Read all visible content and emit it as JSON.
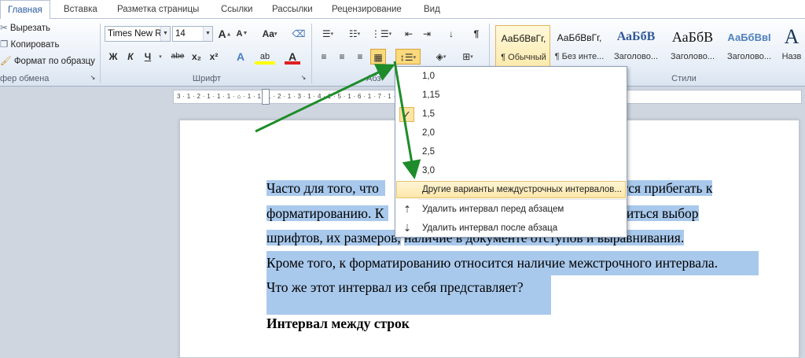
{
  "tabs": [
    "Главная",
    "Вставка",
    "Разметка страницы",
    "Ссылки",
    "Рассылки",
    "Рецензирование",
    "Вид"
  ],
  "clipboard": {
    "cut": "Вырезать",
    "copy": "Копировать",
    "format_painter": "Формат по образцу",
    "group_label": "фер обмена"
  },
  "font": {
    "font_name": "Times New Rc",
    "font_size": "14",
    "group_label": "Шрифт",
    "grow": "A",
    "shrink": "A",
    "change_case": "Aa",
    "bold": "Ж",
    "italic": "К",
    "underline": "Ч",
    "strike": "abe",
    "subscript": "x₂",
    "superscript": "x²",
    "text_effects": "A",
    "highlight": "ab",
    "font_color": "A"
  },
  "paragraph": {
    "group_label": "Абз"
  },
  "styles": {
    "group_label": "Стили",
    "items": [
      {
        "sample": "АаБбВвГг,",
        "caption": "¶ Обычный"
      },
      {
        "sample": "АаБбВвГг,",
        "caption": "¶ Без инте..."
      },
      {
        "sample": "АаБбВ",
        "caption": "Заголово..."
      },
      {
        "sample": "АаБбВ",
        "caption": "Заголово..."
      },
      {
        "sample": "АаБбВвI",
        "caption": "Заголово..."
      },
      {
        "sample": "А",
        "caption": "Назв"
      }
    ]
  },
  "ruler": "3 · 1 · 2 · 1 · 1 · 1 · ⌂ · 1 · 1 · 1 · 2 · 1 · 3 · 1 · 4 · 1 · 5 · 1 · 6 · 1 · 7 · 1 · 8 · 1 · 9 · 1 · 10 · 1 · 11 · 1 · 12 · 1 · 13 · 1 · 14 · 1 · 15 · 1 · 16 · 1 △ 17 · 1",
  "spacing_menu": {
    "options": [
      "1,0",
      "1,15",
      "1,5",
      "2,0",
      "2,5",
      "3,0"
    ],
    "checked": "1,5",
    "more": "Другие варианты междустрочных интервалов...",
    "remove_before": "Удалить интервал перед абзацем",
    "remove_after": "Удалить интервал после абзаца"
  },
  "document": {
    "line1_a": "Часто для того, что",
    "line1_b": "одится прибегать к",
    "line2_a": "форматированию. К",
    "line2_b": "относиться выбор",
    "line3_a": "шрифтов, их размеров,",
    "line3_b": "наличие в документе отступов и выравнивания.",
    "line4": "Кроме того, к форматированию относится наличие межстрочного интервала.",
    "line5": "Что же этот интервал из себя представляет?",
    "heading": "Интервал между строк"
  },
  "colors": {
    "selection": "#a9c9ec",
    "arrow": "#1e8c2a",
    "menu_hover": "#fde7a9",
    "font_color_bar": "#e02020",
    "highlight_bar": "#ffff00"
  }
}
